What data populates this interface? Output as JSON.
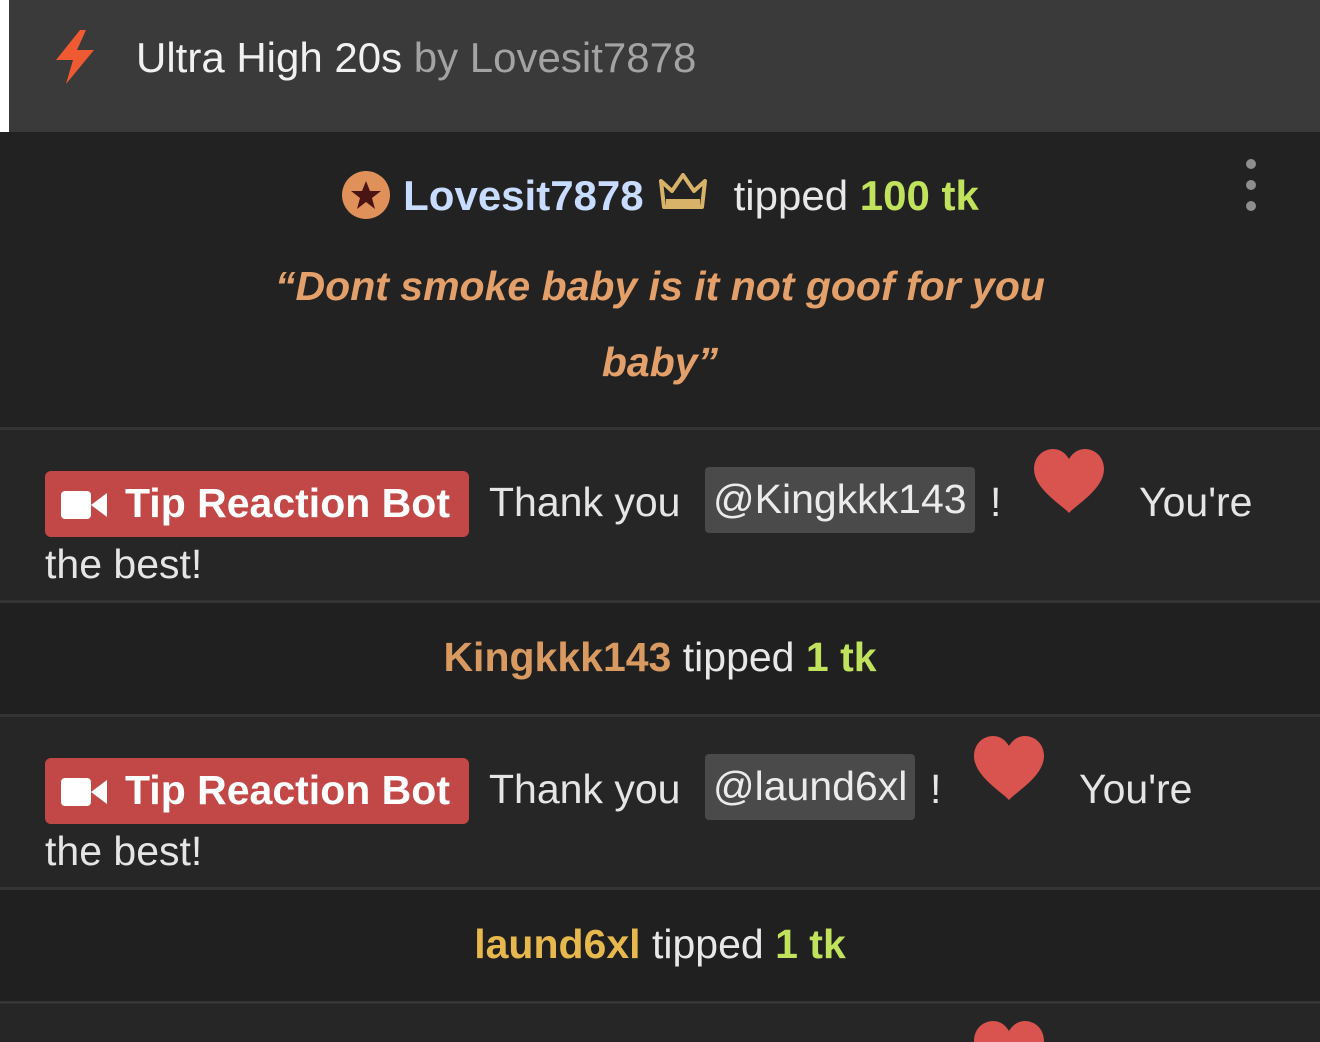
{
  "header": {
    "show_name": "Ultra High 20s",
    "by_text": "by Lovesit7878",
    "icon": "lightning-bolt-icon",
    "accent": "#f05a32"
  },
  "main_tip": {
    "username": "Lovesit7878",
    "badge_icon": "star-badge-icon",
    "crown_icon": "crown-icon",
    "tipped_word": "tipped",
    "amount": "100 tk",
    "message": "“Dont smoke baby is it not goof for you baby”",
    "menu_icon": "more-options-icon"
  },
  "messages": [
    {
      "bot_label": "Tip Reaction Bot",
      "thank_text": "Thank you",
      "mention": "@Kingkkk143",
      "excl": "!",
      "youre": "You're",
      "continuation": "the best!"
    },
    {
      "bot_label": "Tip Reaction Bot",
      "thank_text": "Thank you",
      "mention": "@laund6xl",
      "excl": "!",
      "youre": "You're",
      "continuation": "the best!"
    }
  ],
  "tips": [
    {
      "user": "Kingkkk143",
      "tipped_word": "tipped",
      "amount": "1 tk",
      "user_color": "#d99a62"
    },
    {
      "user": "laund6xl",
      "tipped_word": "tipped",
      "amount": "1 tk",
      "user_color": "#e6b84d"
    }
  ],
  "colors": {
    "bot_badge": "#c24848",
    "heart": "#d9534f",
    "amount": "#c1e25c",
    "quote": "#e4a06a",
    "username": "#c8dcff"
  }
}
